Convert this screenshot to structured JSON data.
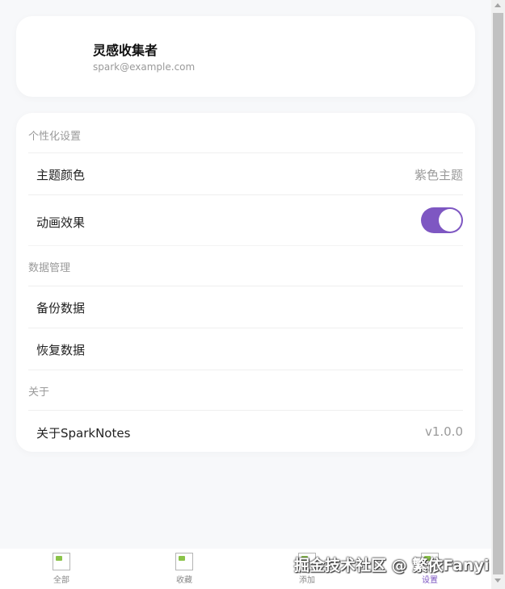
{
  "profile": {
    "name": "灵感收集者",
    "email": "spark@example.com"
  },
  "settings": {
    "section_personalization": "个性化设置",
    "theme_label": "主题颜色",
    "theme_value": "紫色主题",
    "animation_label": "动画效果",
    "animation_enabled": true,
    "section_data": "数据管理",
    "backup_label": "备份数据",
    "restore_label": "恢复数据",
    "section_about": "关于",
    "about_label": "关于SparkNotes",
    "version": "v1.0.0"
  },
  "nav": {
    "items": [
      {
        "label": "全部",
        "icon": "all-icon"
      },
      {
        "label": "收藏",
        "icon": "favorite-icon"
      },
      {
        "label": "添加",
        "icon": "add-icon"
      },
      {
        "label": "设置",
        "icon": "settings-icon",
        "active": true
      }
    ]
  },
  "watermark": "掘金技术社区 @ 繁依Fanyi",
  "colors": {
    "accent": "#7e57c2",
    "background": "#f7f8fa"
  }
}
